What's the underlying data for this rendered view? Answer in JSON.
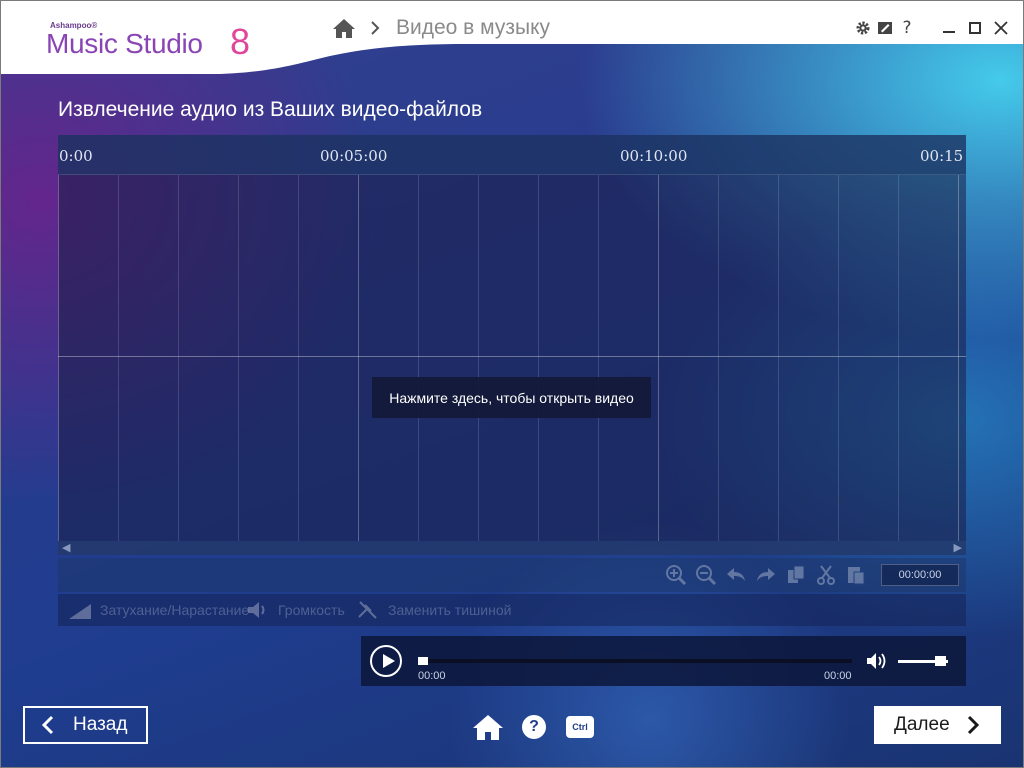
{
  "app": {
    "brand": "Ashampoo®",
    "product": "Music Studio",
    "version": "8"
  },
  "breadcrumb": {
    "home_icon": "home-icon",
    "title": "Видео в музыку"
  },
  "window_controls": {
    "settings_icon": "gear-icon",
    "edit_icon": "edit-icon",
    "help_label": "?",
    "minimize_icon": "minimize-icon",
    "maximize_icon": "maximize-icon",
    "close_icon": "close-icon"
  },
  "page": {
    "title": "Извлечение аудио из Ваших видео-файлов"
  },
  "timeline": {
    "ticks": [
      "0:00",
      "00:05:00",
      "00:10:00",
      "00:15"
    ],
    "open_hint": "Нажмите здесь, чтобы открыть видео"
  },
  "edit_toolbar": {
    "tools": [
      "zoom-in-icon",
      "zoom-out-icon",
      "undo-icon",
      "redo-icon",
      "copy-icon",
      "cut-icon",
      "paste-icon"
    ],
    "time": "00:00:00"
  },
  "effects_toolbar": {
    "items": [
      {
        "icon": "fade-icon",
        "label": "Затухание/Нарастание"
      },
      {
        "icon": "volume-icon",
        "label": "Громкость"
      },
      {
        "icon": "silence-icon",
        "label": "Заменить тишиной"
      }
    ]
  },
  "player": {
    "time_current": "00:00",
    "time_total": "00:00",
    "progress": 0,
    "volume": 0.8
  },
  "footer": {
    "back_label": "Назад",
    "next_label": "Далее",
    "home_icon": "home-icon",
    "help_label": "?",
    "ctrl_label": "Ctrl"
  },
  "colors": {
    "logo_purple": "#8a45b5",
    "logo_pink": "#e0479a",
    "background": "#283c8e",
    "accent_cyan": "#46d2f0"
  }
}
